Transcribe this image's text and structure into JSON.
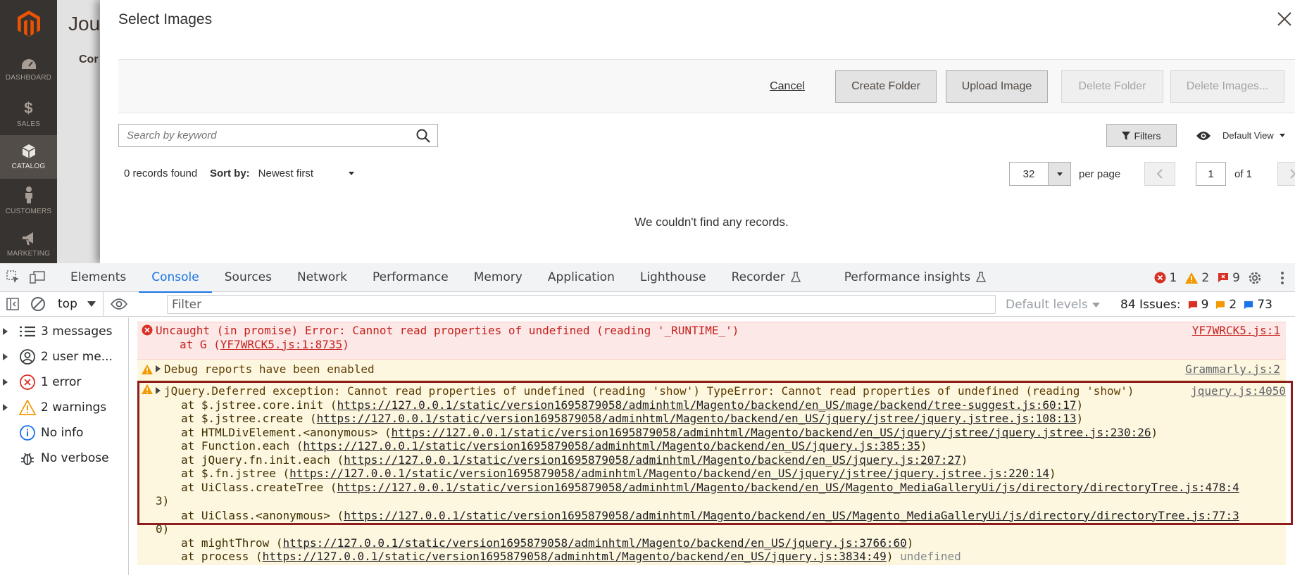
{
  "admin": {
    "nav": [
      {
        "label": "DASHBOARD",
        "icon": "dashboard-icon"
      },
      {
        "label": "SALES",
        "icon": "dollar-icon"
      },
      {
        "label": "CATALOG",
        "icon": "box-icon"
      },
      {
        "label": "CUSTOMERS",
        "icon": "person-icon"
      },
      {
        "label": "MARKETING",
        "icon": "megaphone-icon"
      }
    ],
    "active_nav": "CATALOG",
    "page_title": "Jous",
    "sub_title": "Cor"
  },
  "modal": {
    "title": "Select Images",
    "actions": {
      "cancel": "Cancel",
      "create_folder": "Create Folder",
      "upload_image": "Upload Image",
      "delete_folder": "Delete Folder",
      "delete_images": "Delete Images..."
    },
    "search_placeholder": "Search by keyword",
    "filters": "Filters",
    "view": "Default View",
    "records_found": "0 records found",
    "sort_label": "Sort by:",
    "sort_value": "Newest first",
    "per_page_value": "32",
    "per_page_label": "per page",
    "page_value": "1",
    "page_of": "of 1",
    "empty_message": "We couldn't find any records."
  },
  "devtools": {
    "tabs": [
      "Elements",
      "Console",
      "Sources",
      "Network",
      "Performance",
      "Memory",
      "Application",
      "Lighthouse",
      "Recorder",
      "Performance insights"
    ],
    "active_tab": "Console",
    "counts": {
      "errors": "1",
      "warnings": "2",
      "issues": "9"
    },
    "context": "top",
    "filter_placeholder": "Filter",
    "levels": "Default levels",
    "issues_label": "84 Issues:",
    "issue_counts": {
      "red": "9",
      "yellow": "2",
      "blue": "73"
    },
    "sidebar": [
      {
        "label": "3 messages",
        "icon": "list-icon"
      },
      {
        "label": "2 user me...",
        "icon": "user-icon"
      },
      {
        "label": "1 error",
        "icon": "error-icon"
      },
      {
        "label": "2 warnings",
        "icon": "warning-icon"
      },
      {
        "label": "No info",
        "icon": "info-icon"
      },
      {
        "label": "No verbose",
        "icon": "bug-icon"
      }
    ],
    "messages": {
      "error": {
        "text": "Uncaught (in promise) Error: Cannot read properties of undefined (reading '_RUNTIME_')",
        "at_prefix": "at G (",
        "at_link": "YF7WRCK5.js:1:8735",
        "at_suffix": ")",
        "source": "YF7WRCK5.js:1"
      },
      "warn1": {
        "text": "Debug reports have been enabled",
        "source": "Grammarly.js:2"
      },
      "warn2": {
        "text": "jQuery.Deferred exception: Cannot read properties of undefined (reading 'show') TypeError: Cannot read properties of undefined (reading 'show')",
        "source": "jquery.js:4050",
        "stack": [
          {
            "fn": "at $.jstree.core.init (",
            "url": "https://127.0.0.1/static/version1695879058/adminhtml/Magento/backend/en_US/mage/backend/tree-suggest.js:60:17",
            "end": ")"
          },
          {
            "fn": "at $.jstree.create (",
            "url": "https://127.0.0.1/static/version1695879058/adminhtml/Magento/backend/en_US/jquery/jstree/jquery.jstree.js:108:13",
            "end": ")"
          },
          {
            "fn": "at HTMLDivElement.<anonymous> (",
            "url": "https://127.0.0.1/static/version1695879058/adminhtml/Magento/backend/en_US/jquery/jstree/jquery.jstree.js:230:26",
            "end": ")"
          },
          {
            "fn": "at Function.each (",
            "url": "https://127.0.0.1/static/version1695879058/adminhtml/Magento/backend/en_US/jquery.js:385:35",
            "end": ")"
          },
          {
            "fn": "at jQuery.fn.init.each (",
            "url": "https://127.0.0.1/static/version1695879058/adminhtml/Magento/backend/en_US/jquery.js:207:27",
            "end": ")"
          },
          {
            "fn": "at $.fn.jstree (",
            "url": "https://127.0.0.1/static/version1695879058/adminhtml/Magento/backend/en_US/jquery/jstree/jquery.jstree.js:220:14",
            "end": ")"
          },
          {
            "fn": "at UiClass.createTree (",
            "url": "https://127.0.0.1/static/version1695879058/adminhtml/Magento/backend/en_US/Magento_MediaGalleryUi/js/directory/directoryTree.js:478:4",
            "wrap": "3)"
          },
          {
            "fn": "at UiClass.<anonymous> (",
            "url": "https://127.0.0.1/static/version1695879058/adminhtml/Magento/backend/en_US/Magento_MediaGalleryUi/js/directory/directoryTree.js:77:3",
            "wrap": "0)"
          },
          {
            "fn": "at mightThrow (",
            "url": "https://127.0.0.1/static/version1695879058/adminhtml/Magento/backend/en_US/jquery.js:3766:60",
            "end": ")"
          },
          {
            "fn": "at process (",
            "url": "https://127.0.0.1/static/version1695879058/adminhtml/Magento/backend/en_US/jquery.js:3834:49",
            "end": ")",
            "tail": "undefined"
          }
        ]
      }
    }
  },
  "colors": {
    "magento_orange": "#eb5202",
    "sidebar_bg": "#373330",
    "devtools_blue": "#1a73e8",
    "error_red": "#d93025",
    "warning_amber": "#f29900"
  }
}
